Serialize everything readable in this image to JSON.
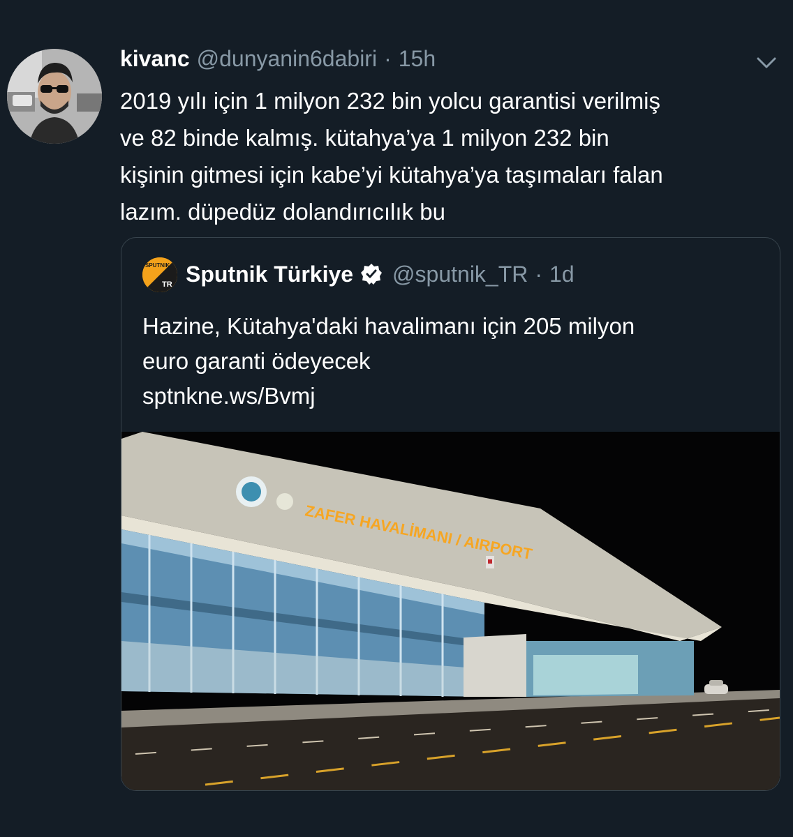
{
  "tweet": {
    "author_name": "kivanc",
    "author_handle": "@dunyanin6dabiri",
    "separator": "·",
    "time": "15h",
    "text_lines": [
      "2019 yılı için 1 milyon 232 bin yolcu garantisi verilmiş",
      "ve 82 binde kalmış. kütahya’ya 1 milyon 232 bin",
      "kişinin gitmesi için kabe’yi kütahya’ya taşımaları falan",
      "lazım. düpedüz dolandırıcılık bu"
    ],
    "avatar_icon": "profile-photo",
    "menu_icon": "chevron-down-icon"
  },
  "quoted": {
    "author_name": "Sputnik Türkiye",
    "author_handle": "@sputnik_TR",
    "separator": "·",
    "time": "1d",
    "verified_icon": "verified-badge-icon",
    "avatar_logo_text": "SPUTNIK",
    "avatar_badge_text": "TR",
    "text_lines": [
      "Hazine, Kütahya'daki havalimanı için 205 milyon",
      "euro garanti ödeyecek",
      "sptnkne.ws/Bvmj"
    ],
    "photo": {
      "sign_text": "ZAFER HAVALİMANI / AIRPORT"
    }
  },
  "colors": {
    "background": "#141d26",
    "text_primary": "#ffffff",
    "text_secondary": "#8899a6",
    "border": "#38444d",
    "sign": "#f6a623"
  }
}
